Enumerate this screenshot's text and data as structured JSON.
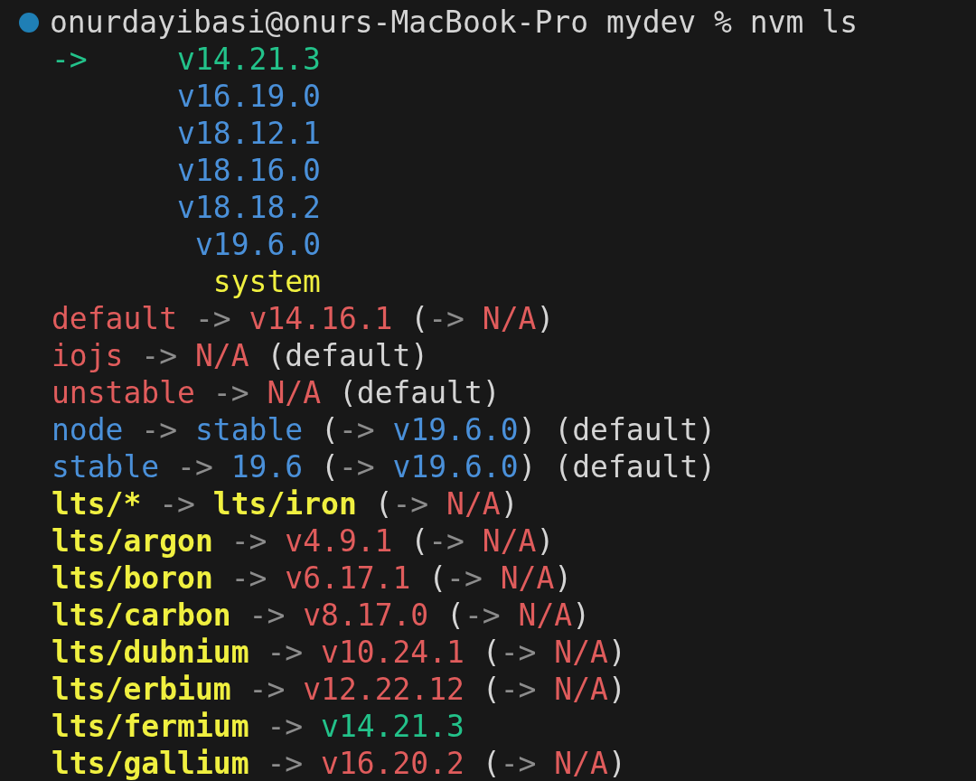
{
  "prompt": {
    "text": "onurdayibasi@onurs-MacBook-Pro mydev % nvm ls",
    "color": "#1f7fb5"
  },
  "versions": [
    {
      "marker": "->",
      "version": "v14.21.3",
      "color": "#23c28a"
    },
    {
      "version": "v16.19.0",
      "color": "#4a90d9"
    },
    {
      "version": "v18.12.1",
      "color": "#4a90d9"
    },
    {
      "version": "v18.16.0",
      "color": "#4a90d9"
    },
    {
      "version": "v18.18.2",
      "color": "#4a90d9"
    },
    {
      "version": "v19.6.0",
      "color": "#4a90d9"
    },
    {
      "version": "system",
      "color": "#f0f040"
    }
  ],
  "aliases": [
    [
      {
        "text": "default",
        "color": "#e05c5c"
      },
      {
        "text": "->",
        "color": "#8c8c8c",
        "space_before": true
      },
      {
        "text": "v14.16.1",
        "color": "#e05c5c",
        "space_before": true
      },
      {
        "text": "(",
        "color": "#d4d4d4",
        "space_before": true
      },
      {
        "text": "->",
        "color": "#8c8c8c"
      },
      {
        "text": "N/A",
        "color": "#e05c5c",
        "space_before": true
      },
      {
        "text": ")",
        "color": "#d4d4d4"
      }
    ],
    [
      {
        "text": "iojs",
        "color": "#e05c5c"
      },
      {
        "text": "->",
        "color": "#8c8c8c",
        "space_before": true
      },
      {
        "text": "N/A",
        "color": "#e05c5c",
        "space_before": true
      },
      {
        "text": "(default)",
        "color": "#d4d4d4",
        "space_before": true
      }
    ],
    [
      {
        "text": "unstable",
        "color": "#e05c5c"
      },
      {
        "text": "->",
        "color": "#8c8c8c",
        "space_before": true
      },
      {
        "text": "N/A",
        "color": "#e05c5c",
        "space_before": true
      },
      {
        "text": "(default)",
        "color": "#d4d4d4",
        "space_before": true
      }
    ],
    [
      {
        "text": "node",
        "color": "#4a90d9"
      },
      {
        "text": "->",
        "color": "#8c8c8c",
        "space_before": true
      },
      {
        "text": "stable",
        "color": "#4a90d9",
        "space_before": true
      },
      {
        "text": "(",
        "color": "#d4d4d4",
        "space_before": true
      },
      {
        "text": "->",
        "color": "#8c8c8c"
      },
      {
        "text": "v19.6.0",
        "color": "#4a90d9",
        "space_before": true
      },
      {
        "text": ")",
        "color": "#d4d4d4"
      },
      {
        "text": "(default)",
        "color": "#d4d4d4",
        "space_before": true
      }
    ],
    [
      {
        "text": "stable",
        "color": "#4a90d9"
      },
      {
        "text": "->",
        "color": "#8c8c8c",
        "space_before": true
      },
      {
        "text": "19.6",
        "color": "#4a90d9",
        "space_before": true
      },
      {
        "text": "(",
        "color": "#d4d4d4",
        "space_before": true
      },
      {
        "text": "->",
        "color": "#8c8c8c"
      },
      {
        "text": "v19.6.0",
        "color": "#4a90d9",
        "space_before": true
      },
      {
        "text": ")",
        "color": "#d4d4d4"
      },
      {
        "text": "(default)",
        "color": "#d4d4d4",
        "space_before": true
      }
    ],
    [
      {
        "text": "lts/*",
        "color": "#f0f040",
        "bold": true
      },
      {
        "text": "->",
        "color": "#8c8c8c",
        "space_before": true
      },
      {
        "text": "lts/iron",
        "color": "#f0f040",
        "bold": true,
        "space_before": true
      },
      {
        "text": "(",
        "color": "#d4d4d4",
        "space_before": true
      },
      {
        "text": "->",
        "color": "#8c8c8c"
      },
      {
        "text": "N/A",
        "color": "#e05c5c",
        "space_before": true
      },
      {
        "text": ")",
        "color": "#d4d4d4"
      }
    ],
    [
      {
        "text": "lts/argon",
        "color": "#f0f040",
        "bold": true
      },
      {
        "text": "->",
        "color": "#8c8c8c",
        "space_before": true
      },
      {
        "text": "v4.9.1",
        "color": "#e05c5c",
        "space_before": true
      },
      {
        "text": "(",
        "color": "#d4d4d4",
        "space_before": true
      },
      {
        "text": "->",
        "color": "#8c8c8c"
      },
      {
        "text": "N/A",
        "color": "#e05c5c",
        "space_before": true
      },
      {
        "text": ")",
        "color": "#d4d4d4"
      }
    ],
    [
      {
        "text": "lts/boron",
        "color": "#f0f040",
        "bold": true
      },
      {
        "text": "->",
        "color": "#8c8c8c",
        "space_before": true
      },
      {
        "text": "v6.17.1",
        "color": "#e05c5c",
        "space_before": true
      },
      {
        "text": "(",
        "color": "#d4d4d4",
        "space_before": true
      },
      {
        "text": "->",
        "color": "#8c8c8c"
      },
      {
        "text": "N/A",
        "color": "#e05c5c",
        "space_before": true
      },
      {
        "text": ")",
        "color": "#d4d4d4"
      }
    ],
    [
      {
        "text": "lts/carbon",
        "color": "#f0f040",
        "bold": true
      },
      {
        "text": "->",
        "color": "#8c8c8c",
        "space_before": true
      },
      {
        "text": "v8.17.0",
        "color": "#e05c5c",
        "space_before": true
      },
      {
        "text": "(",
        "color": "#d4d4d4",
        "space_before": true
      },
      {
        "text": "->",
        "color": "#8c8c8c"
      },
      {
        "text": "N/A",
        "color": "#e05c5c",
        "space_before": true
      },
      {
        "text": ")",
        "color": "#d4d4d4"
      }
    ],
    [
      {
        "text": "lts/dubnium",
        "color": "#f0f040",
        "bold": true
      },
      {
        "text": "->",
        "color": "#8c8c8c",
        "space_before": true
      },
      {
        "text": "v10.24.1",
        "color": "#e05c5c",
        "space_before": true
      },
      {
        "text": "(",
        "color": "#d4d4d4",
        "space_before": true
      },
      {
        "text": "->",
        "color": "#8c8c8c"
      },
      {
        "text": "N/A",
        "color": "#e05c5c",
        "space_before": true
      },
      {
        "text": ")",
        "color": "#d4d4d4"
      }
    ],
    [
      {
        "text": "lts/erbium",
        "color": "#f0f040",
        "bold": true
      },
      {
        "text": "->",
        "color": "#8c8c8c",
        "space_before": true
      },
      {
        "text": "v12.22.12",
        "color": "#e05c5c",
        "space_before": true
      },
      {
        "text": "(",
        "color": "#d4d4d4",
        "space_before": true
      },
      {
        "text": "->",
        "color": "#8c8c8c"
      },
      {
        "text": "N/A",
        "color": "#e05c5c",
        "space_before": true
      },
      {
        "text": ")",
        "color": "#d4d4d4"
      }
    ],
    [
      {
        "text": "lts/fermium",
        "color": "#f0f040",
        "bold": true
      },
      {
        "text": "->",
        "color": "#8c8c8c",
        "space_before": true
      },
      {
        "text": "v14.21.3",
        "color": "#23c28a",
        "space_before": true
      }
    ],
    [
      {
        "text": "lts/gallium",
        "color": "#f0f040",
        "bold": true
      },
      {
        "text": "->",
        "color": "#8c8c8c",
        "space_before": true
      },
      {
        "text": "v16.20.2",
        "color": "#e05c5c",
        "space_before": true
      },
      {
        "text": "(",
        "color": "#d4d4d4",
        "space_before": true
      },
      {
        "text": "->",
        "color": "#8c8c8c"
      },
      {
        "text": "N/A",
        "color": "#e05c5c",
        "space_before": true
      },
      {
        "text": ")",
        "color": "#d4d4d4"
      }
    ]
  ]
}
